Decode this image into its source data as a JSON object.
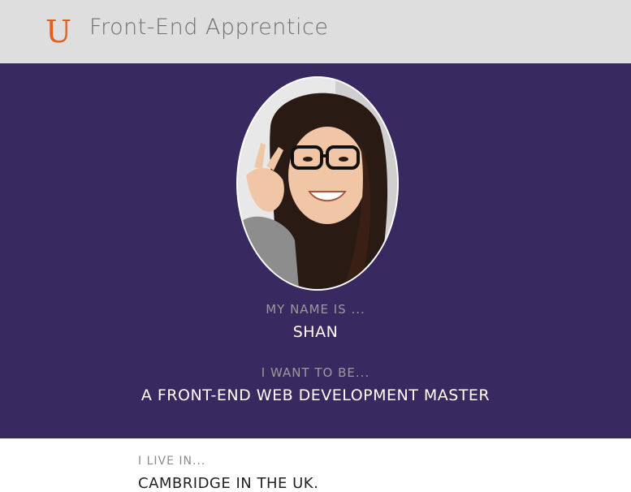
{
  "header": {
    "logo": "U",
    "title": "Front-End Apprentice",
    "background": "#dedede",
    "logo_color": "#e06020"
  },
  "hero": {
    "background": "#382a60",
    "photo": {
      "description_icon": "profile-photo"
    },
    "name_label": "My name is ...",
    "name_value": "Shan",
    "goal_label": "I want to be...",
    "goal_value": "A Front-End Web Development Master"
  },
  "about": {
    "location_label": "I live in...",
    "location_value": "Cambridge in the UK."
  }
}
